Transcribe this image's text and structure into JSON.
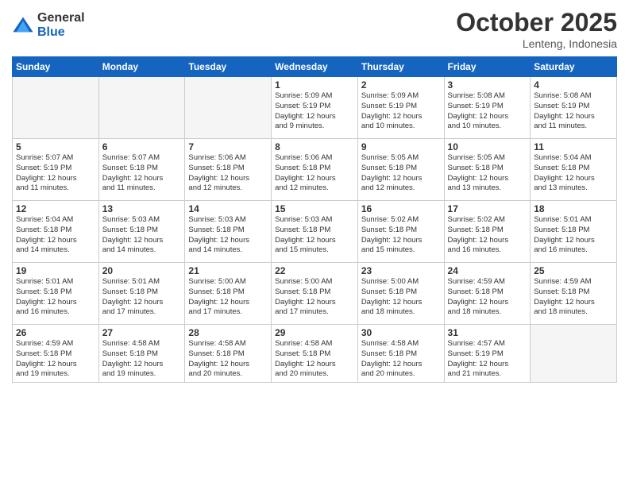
{
  "logo": {
    "general": "General",
    "blue": "Blue"
  },
  "title": "October 2025",
  "location": "Lenteng, Indonesia",
  "days_header": [
    "Sunday",
    "Monday",
    "Tuesday",
    "Wednesday",
    "Thursday",
    "Friday",
    "Saturday"
  ],
  "weeks": [
    [
      {
        "day": "",
        "info": ""
      },
      {
        "day": "",
        "info": ""
      },
      {
        "day": "",
        "info": ""
      },
      {
        "day": "1",
        "info": "Sunrise: 5:09 AM\nSunset: 5:19 PM\nDaylight: 12 hours\nand 9 minutes."
      },
      {
        "day": "2",
        "info": "Sunrise: 5:09 AM\nSunset: 5:19 PM\nDaylight: 12 hours\nand 10 minutes."
      },
      {
        "day": "3",
        "info": "Sunrise: 5:08 AM\nSunset: 5:19 PM\nDaylight: 12 hours\nand 10 minutes."
      },
      {
        "day": "4",
        "info": "Sunrise: 5:08 AM\nSunset: 5:19 PM\nDaylight: 12 hours\nand 11 minutes."
      }
    ],
    [
      {
        "day": "5",
        "info": "Sunrise: 5:07 AM\nSunset: 5:19 PM\nDaylight: 12 hours\nand 11 minutes."
      },
      {
        "day": "6",
        "info": "Sunrise: 5:07 AM\nSunset: 5:18 PM\nDaylight: 12 hours\nand 11 minutes."
      },
      {
        "day": "7",
        "info": "Sunrise: 5:06 AM\nSunset: 5:18 PM\nDaylight: 12 hours\nand 12 minutes."
      },
      {
        "day": "8",
        "info": "Sunrise: 5:06 AM\nSunset: 5:18 PM\nDaylight: 12 hours\nand 12 minutes."
      },
      {
        "day": "9",
        "info": "Sunrise: 5:05 AM\nSunset: 5:18 PM\nDaylight: 12 hours\nand 12 minutes."
      },
      {
        "day": "10",
        "info": "Sunrise: 5:05 AM\nSunset: 5:18 PM\nDaylight: 12 hours\nand 13 minutes."
      },
      {
        "day": "11",
        "info": "Sunrise: 5:04 AM\nSunset: 5:18 PM\nDaylight: 12 hours\nand 13 minutes."
      }
    ],
    [
      {
        "day": "12",
        "info": "Sunrise: 5:04 AM\nSunset: 5:18 PM\nDaylight: 12 hours\nand 14 minutes."
      },
      {
        "day": "13",
        "info": "Sunrise: 5:03 AM\nSunset: 5:18 PM\nDaylight: 12 hours\nand 14 minutes."
      },
      {
        "day": "14",
        "info": "Sunrise: 5:03 AM\nSunset: 5:18 PM\nDaylight: 12 hours\nand 14 minutes."
      },
      {
        "day": "15",
        "info": "Sunrise: 5:03 AM\nSunset: 5:18 PM\nDaylight: 12 hours\nand 15 minutes."
      },
      {
        "day": "16",
        "info": "Sunrise: 5:02 AM\nSunset: 5:18 PM\nDaylight: 12 hours\nand 15 minutes."
      },
      {
        "day": "17",
        "info": "Sunrise: 5:02 AM\nSunset: 5:18 PM\nDaylight: 12 hours\nand 16 minutes."
      },
      {
        "day": "18",
        "info": "Sunrise: 5:01 AM\nSunset: 5:18 PM\nDaylight: 12 hours\nand 16 minutes."
      }
    ],
    [
      {
        "day": "19",
        "info": "Sunrise: 5:01 AM\nSunset: 5:18 PM\nDaylight: 12 hours\nand 16 minutes."
      },
      {
        "day": "20",
        "info": "Sunrise: 5:01 AM\nSunset: 5:18 PM\nDaylight: 12 hours\nand 17 minutes."
      },
      {
        "day": "21",
        "info": "Sunrise: 5:00 AM\nSunset: 5:18 PM\nDaylight: 12 hours\nand 17 minutes."
      },
      {
        "day": "22",
        "info": "Sunrise: 5:00 AM\nSunset: 5:18 PM\nDaylight: 12 hours\nand 17 minutes."
      },
      {
        "day": "23",
        "info": "Sunrise: 5:00 AM\nSunset: 5:18 PM\nDaylight: 12 hours\nand 18 minutes."
      },
      {
        "day": "24",
        "info": "Sunrise: 4:59 AM\nSunset: 5:18 PM\nDaylight: 12 hours\nand 18 minutes."
      },
      {
        "day": "25",
        "info": "Sunrise: 4:59 AM\nSunset: 5:18 PM\nDaylight: 12 hours\nand 18 minutes."
      }
    ],
    [
      {
        "day": "26",
        "info": "Sunrise: 4:59 AM\nSunset: 5:18 PM\nDaylight: 12 hours\nand 19 minutes."
      },
      {
        "day": "27",
        "info": "Sunrise: 4:58 AM\nSunset: 5:18 PM\nDaylight: 12 hours\nand 19 minutes."
      },
      {
        "day": "28",
        "info": "Sunrise: 4:58 AM\nSunset: 5:18 PM\nDaylight: 12 hours\nand 20 minutes."
      },
      {
        "day": "29",
        "info": "Sunrise: 4:58 AM\nSunset: 5:18 PM\nDaylight: 12 hours\nand 20 minutes."
      },
      {
        "day": "30",
        "info": "Sunrise: 4:58 AM\nSunset: 5:18 PM\nDaylight: 12 hours\nand 20 minutes."
      },
      {
        "day": "31",
        "info": "Sunrise: 4:57 AM\nSunset: 5:19 PM\nDaylight: 12 hours\nand 21 minutes."
      },
      {
        "day": "",
        "info": ""
      }
    ]
  ]
}
